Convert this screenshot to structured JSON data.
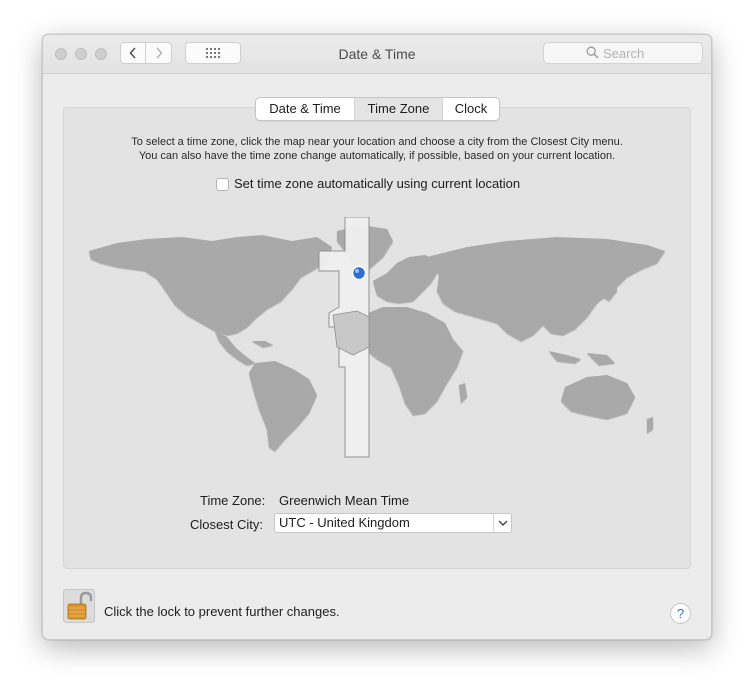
{
  "window": {
    "title": "Date & Time"
  },
  "toolbar": {
    "search_placeholder": "Search"
  },
  "tabs": [
    {
      "label": "Date & Time"
    },
    {
      "label": "Time Zone",
      "selected": true
    },
    {
      "label": "Clock"
    }
  ],
  "timezone": {
    "instruction_line1": "To select a time zone, click the map near your location and choose a city from the Closest City menu.",
    "instruction_line2": "You can also have the time zone change automatically, if possible, based on your current location.",
    "auto_checkbox_label": "Set time zone automatically using current location",
    "auto_checked": false,
    "tz_label": "Time Zone:",
    "tz_value": "Greenwich Mean Time",
    "city_label": "Closest City:",
    "city_value": "UTC - United Kingdom"
  },
  "footer": {
    "lock_text": "Click the lock to prevent further changes.",
    "help_label": "?"
  },
  "colors": {
    "accent": "#2d6fd6",
    "window_bg": "#ececec",
    "panel_bg": "#e3e3e3",
    "map_land": "#a9a9a9",
    "lock_body": "#d9962e"
  }
}
